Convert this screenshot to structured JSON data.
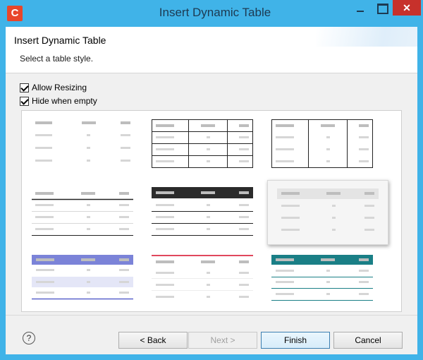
{
  "window": {
    "title": "Insert Dynamic Table",
    "app_icon_letter": "C",
    "close_glyph": "✕"
  },
  "header": {
    "title": "Insert Dynamic Table",
    "subtitle": "Select a table style."
  },
  "options": {
    "allow_resizing": {
      "label": "Allow Resizing",
      "checked": true
    },
    "hide_when_empty": {
      "label": "Hide when empty",
      "checked": true
    }
  },
  "table_styles": {
    "selected_index": 5,
    "items": [
      "plain",
      "bordered-grid",
      "outer-border-vertical-lines",
      "header-rule",
      "dark-header",
      "light-header-card",
      "blue-banded",
      "red-top-rule",
      "teal-header"
    ]
  },
  "footer": {
    "help_glyph": "?",
    "back_label": "< Back",
    "next_label": "Next >",
    "finish_label": "Finish",
    "cancel_label": "Cancel"
  },
  "colors": {
    "titlebar": "#40b3e8",
    "close": "#c7312b",
    "dark_header": "#2b2b2b",
    "blue_header": "#7b83d8",
    "blue_band": "#e4e6f7",
    "red_rule": "#e0475d",
    "teal": "#1a7f86"
  }
}
